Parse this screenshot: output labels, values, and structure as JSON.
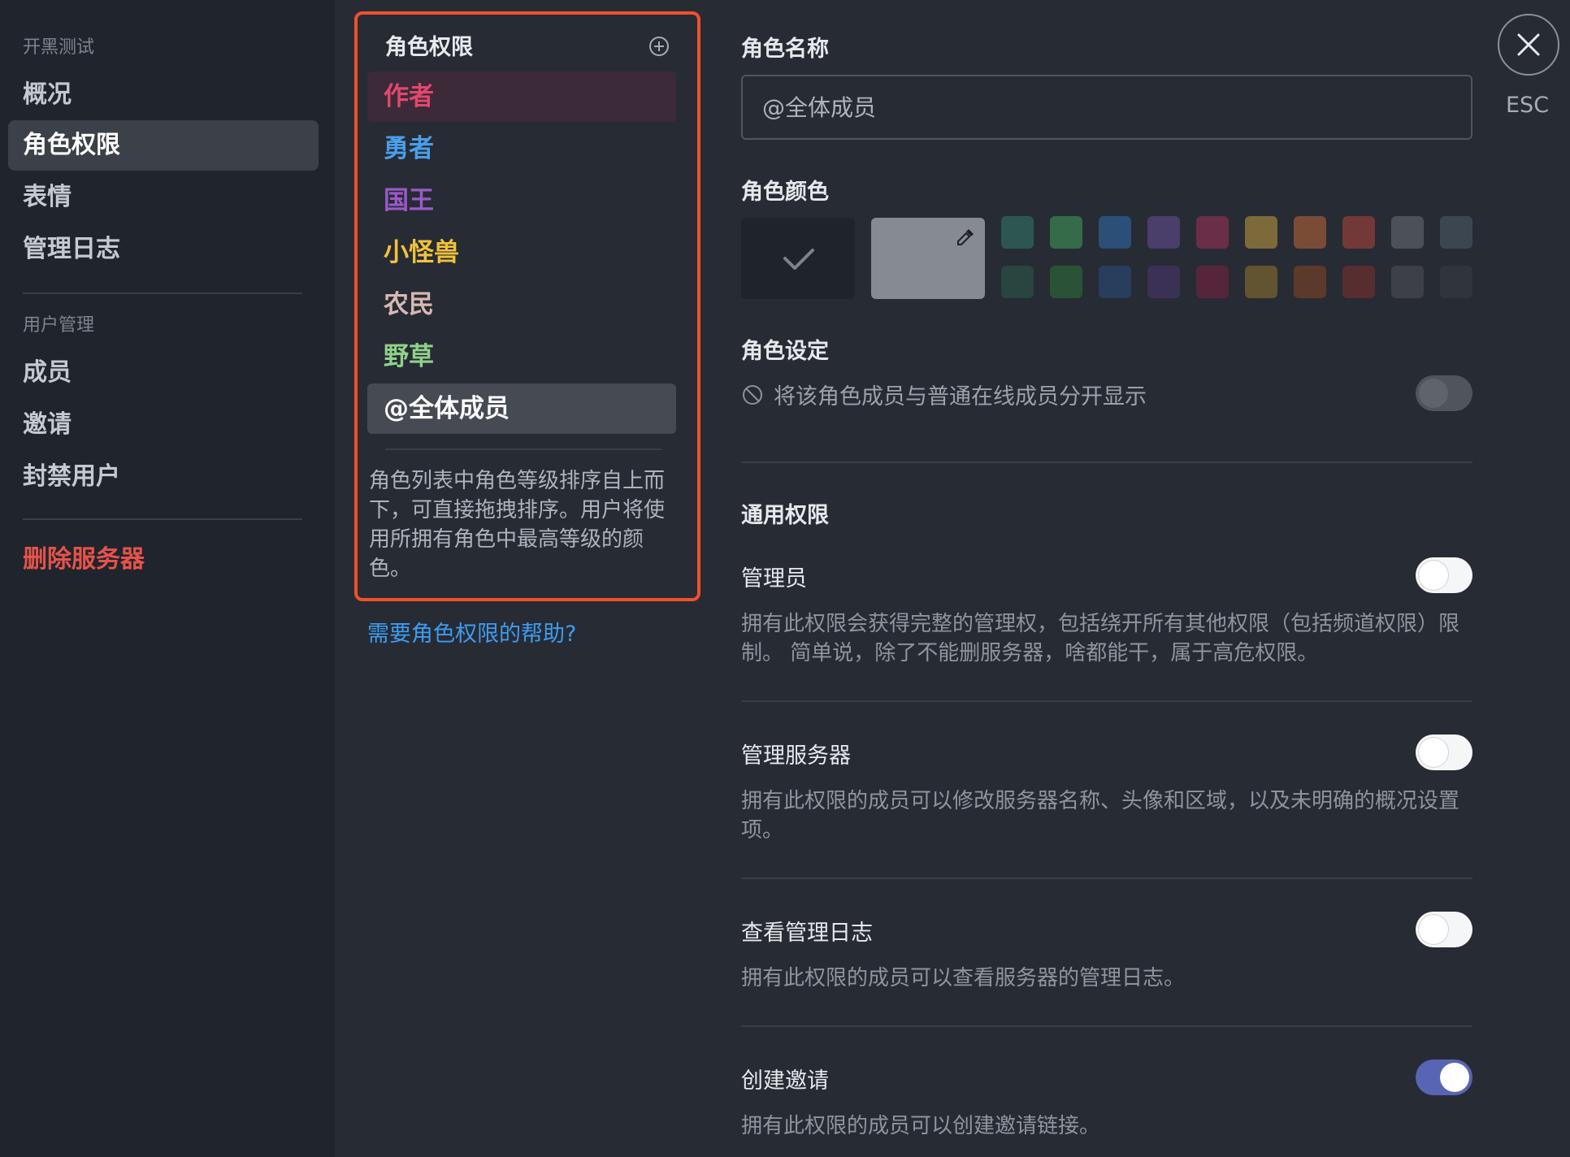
{
  "sidebar": {
    "server_name": "开黑测试",
    "items": [
      {
        "label": "概况"
      },
      {
        "label": "角色权限"
      },
      {
        "label": "表情"
      },
      {
        "label": "管理日志"
      }
    ],
    "user_section": "用户管理",
    "user_items": [
      {
        "label": "成员"
      },
      {
        "label": "邀请"
      },
      {
        "label": "封禁用户"
      }
    ],
    "delete_server": "删除服务器"
  },
  "roles": {
    "header": "角色权限",
    "items": [
      {
        "label": "作者",
        "color": "#e2476e"
      },
      {
        "label": "勇者",
        "color": "#4a9fe8"
      },
      {
        "label": "国王",
        "color": "#9b59c9"
      },
      {
        "label": "小怪兽",
        "color": "#f0c33b"
      },
      {
        "label": "农民",
        "color": "#d8b9b4"
      },
      {
        "label": "野草",
        "color": "#8fd18b"
      },
      {
        "label": "@全体成员",
        "color": "#ffffff"
      }
    ],
    "description": "角色列表中角色等级排序自上而下，可直接拖拽排序。用户将使用所拥有角色中最高等级的颜色。",
    "help_link": "需要角色权限的帮助?"
  },
  "role_name": {
    "label": "角色名称",
    "placeholder": "@全体成员"
  },
  "role_color": {
    "label": "角色颜色",
    "swatches_top": [
      "#2e5651",
      "#356b48",
      "#2c4f78",
      "#4a3e6b",
      "#6a2e48",
      "#7d6a3a",
      "#7a4c35",
      "#723938",
      "#4b5059",
      "#3c4650"
    ],
    "swatches_bottom": [
      "#28453f",
      "#2a5237",
      "#273e5c",
      "#3b3157",
      "#55263b",
      "#625430",
      "#5c3a2b",
      "#582d2f",
      "#3d4048",
      "#30353d"
    ]
  },
  "role_setting": {
    "label": "角色设定",
    "text": "将该角色成员与普通在线成员分开显示"
  },
  "permissions": {
    "section_label": "通用权限",
    "items": [
      {
        "title": "管理员",
        "desc": "拥有此权限会获得完整的管理权，包括绕开所有其他权限（包括频道权限）限制。 简单说，除了不能删服务器，啥都能干，属于高危权限。",
        "enabled": false
      },
      {
        "title": "管理服务器",
        "desc": "拥有此权限的成员可以修改服务器名称、头像和区域，以及未明确的概况设置项。",
        "enabled": false
      },
      {
        "title": "查看管理日志",
        "desc": "拥有此权限的成员可以查看服务器的管理日志。",
        "enabled": false
      },
      {
        "title": "创建邀请",
        "desc": "拥有此权限的成员可以创建邀请链接。",
        "enabled": true
      }
    ]
  },
  "close": {
    "esc_label": "ESC"
  },
  "colors": {
    "accent_toggle": "#5865b4",
    "highlight_border": "#f0502c",
    "danger": "#e5534b",
    "link": "#3e9cf0"
  }
}
